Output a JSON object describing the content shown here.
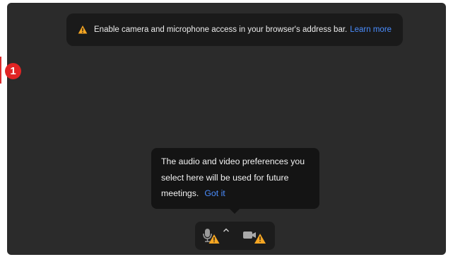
{
  "banner": {
    "message": "Enable camera and microphone access in your browser's address bar.",
    "link": "Learn more",
    "icon": "warning-icon"
  },
  "step_badge": "1",
  "tooltip": {
    "text": "The audio and video preferences you select here will be used for future meetings.",
    "action": "Got it"
  },
  "controls": {
    "mic_icon": "microphone-warning-icon",
    "caret_icon": "chevron-up-icon",
    "camera_icon": "camera-warning-icon"
  },
  "colors": {
    "preview_bg": "#2b2b2b",
    "panel_bg": "#1a1a1a",
    "link": "#4a8dff",
    "warning": "#f5a623",
    "badge": "#e02424"
  }
}
